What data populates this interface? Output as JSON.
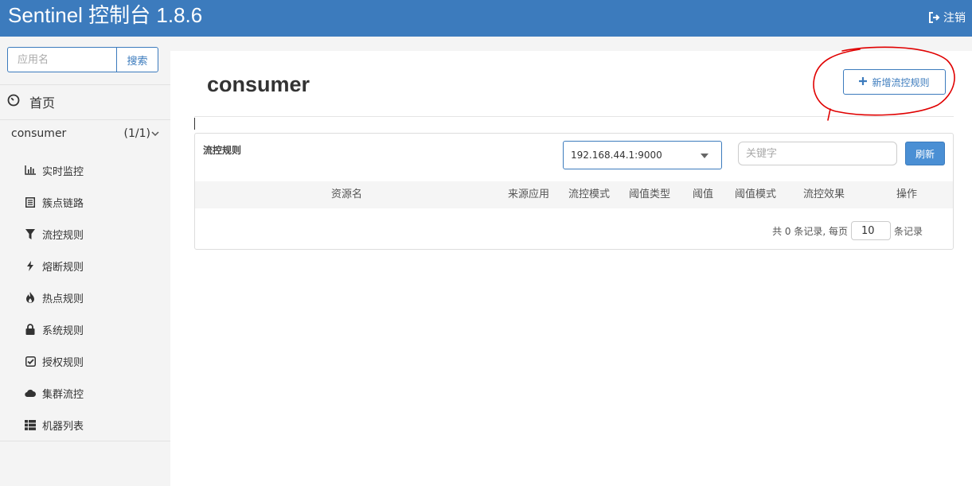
{
  "header": {
    "title": "Sentinel 控制台 1.8.6",
    "logout_label": "注销",
    "bar_color": "#3c7bbd"
  },
  "sidebar": {
    "search_placeholder": "应用名",
    "search_button": "搜索",
    "home_label": "首页",
    "app": {
      "name": "consumer",
      "count": "(1/1)"
    },
    "items": [
      {
        "label": "实时监控",
        "icon": "bar-chart-icon"
      },
      {
        "label": "簇点链路",
        "icon": "list-icon"
      },
      {
        "label": "流控规则",
        "icon": "filter-icon"
      },
      {
        "label": "熔断规则",
        "icon": "flash-icon"
      },
      {
        "label": "热点规则",
        "icon": "fire-icon"
      },
      {
        "label": "系统规则",
        "icon": "lock-icon"
      },
      {
        "label": "授权规则",
        "icon": "check-square-icon"
      },
      {
        "label": "集群流控",
        "icon": "cloud-icon"
      },
      {
        "label": "机器列表",
        "icon": "th-list-icon"
      }
    ]
  },
  "main": {
    "title": "consumer",
    "add_button": "新增流控规则",
    "card": {
      "title": "流控规则",
      "machine": "192.168.44.1:9000",
      "keyword_placeholder": "关键字",
      "refresh": "刷新",
      "columns": [
        "资源名",
        "来源应用",
        "流控模式",
        "阈值类型",
        "阈值",
        "阈值模式",
        "流控效果",
        "操作"
      ],
      "pager": {
        "prefix": "共 0 条记录, 每页",
        "page_size": "10",
        "suffix": "条记录"
      }
    }
  },
  "annotation_color": "#e00000"
}
